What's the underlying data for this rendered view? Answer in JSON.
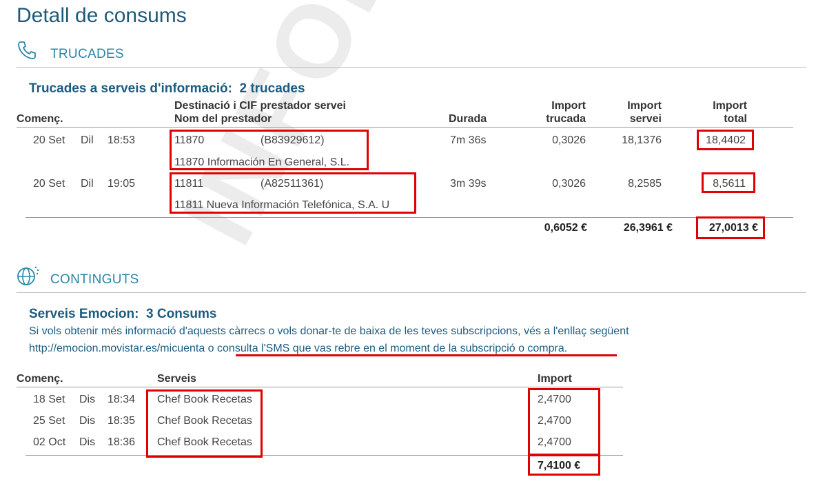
{
  "page_title": "Detall de consums",
  "watermark": "INFORMATIVA",
  "calls": {
    "section_title": "TRUCADES",
    "subtitle_label": "Trucades a serveis d'informació:",
    "subtitle_count": "2 trucades",
    "headers": {
      "start": "Començ.",
      "dest_line1": "Destinació i CIF prestador servei",
      "dest_line2": "Nom del prestador",
      "duration": "Durada",
      "call_amount_1": "Import",
      "call_amount_2": "trucada",
      "service_amount_1": "Import",
      "service_amount_2": "servei",
      "total_amount_1": "Import",
      "total_amount_2": "total"
    },
    "rows": [
      {
        "date": "20 Set",
        "day": "Dil",
        "time": "18:53",
        "number": "11870",
        "cif": "(B83929612)",
        "provider": "11870 Información En General, S.L.",
        "duration": "7m 36s",
        "call_amount": "0,3026",
        "service_amount": "18,1376",
        "total": "18,4402"
      },
      {
        "date": "20 Set",
        "day": "Dil",
        "time": "19:05",
        "number": "11811",
        "cif": "(A82511361)",
        "provider": "11811 Nueva Información Telefónica, S.A. U",
        "duration": "3m 39s",
        "call_amount": "0,3026",
        "service_amount": "8,2585",
        "total": "8,5611"
      }
    ],
    "totals": {
      "call_amount": "0,6052 €",
      "service_amount": "26,3961 €",
      "total": "27,0013 €"
    }
  },
  "contents": {
    "section_title": "CONTINGUTS",
    "subtitle_label": "Serveis Emocion:",
    "subtitle_count": "3 Consums",
    "info_line1": "Si vols obtenir més informació d'aquests càrrecs o vols donar-te de baixa de les teves subscripcions, vés a l'enllaç següent",
    "info_line2_a": "http://emocion.movistar.es/micuenta o ",
    "info_line2_b": "consulta l'SMS que vas rebre en el moment de la subscripció o compra",
    "info_line2_c": ".",
    "headers": {
      "start": "Començ.",
      "services": "Serveis",
      "amount": "Import"
    },
    "rows": [
      {
        "date": "18 Set",
        "day": "Dis",
        "time": "18:34",
        "service": "Chef Book Recetas",
        "amount": "2,4700"
      },
      {
        "date": "25 Set",
        "day": "Dis",
        "time": "18:35",
        "service": "Chef Book Recetas",
        "amount": "2,4700"
      },
      {
        "date": "02 Oct",
        "day": "Dis",
        "time": "18:36",
        "service": "Chef Book Recetas",
        "amount": "2,4700"
      }
    ],
    "total": "7,4100 €"
  },
  "colors": {
    "title": "#1f5a7a",
    "section": "#2a86a8",
    "highlight": "#e00000"
  },
  "icons": {
    "calls": "phone-icon",
    "contents": "globe-icon"
  }
}
